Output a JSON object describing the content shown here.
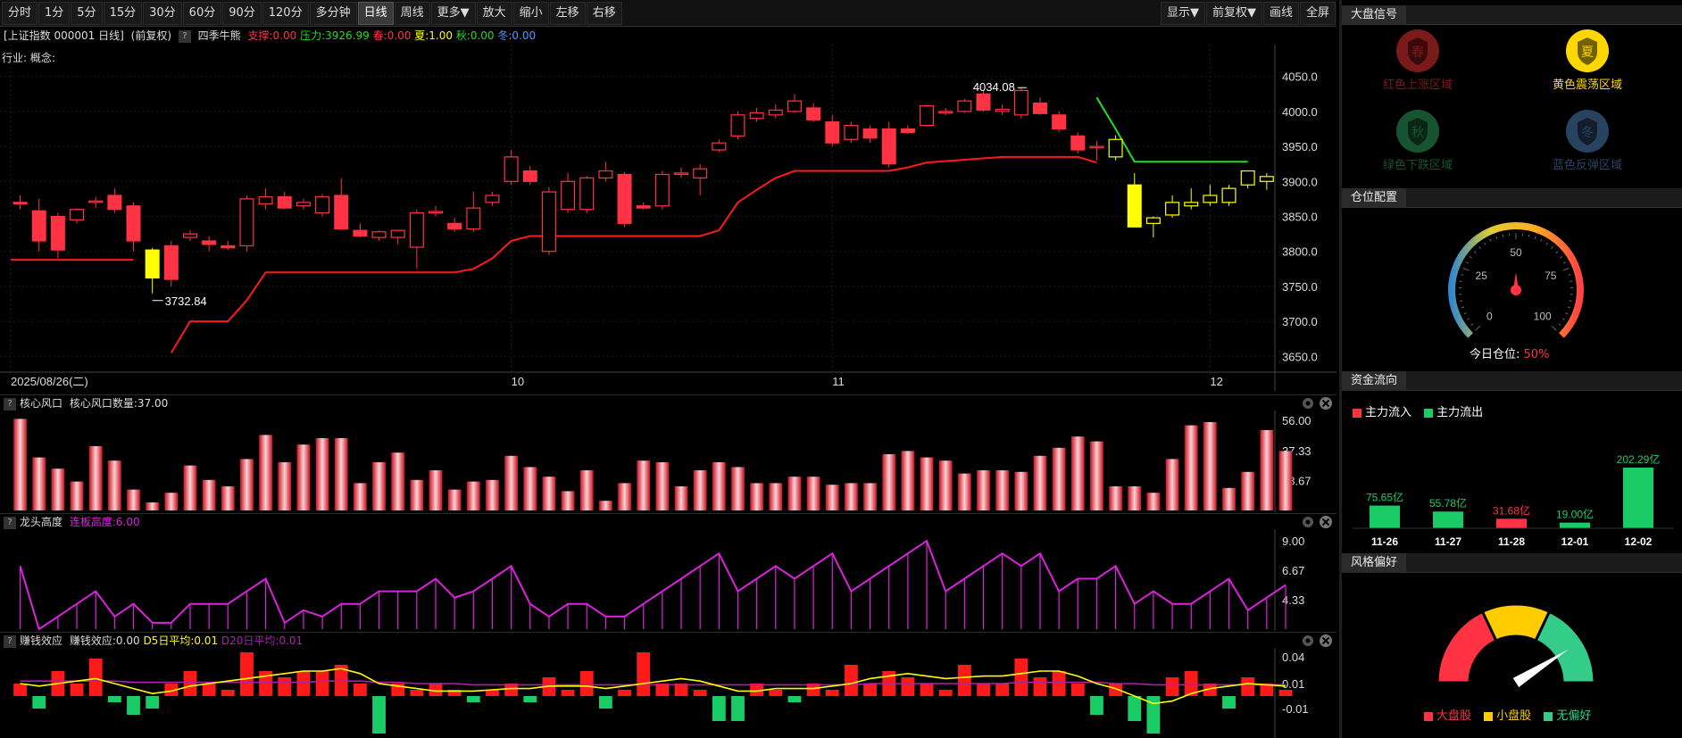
{
  "toolbar": {
    "periods": [
      "分时",
      "1分",
      "5分",
      "15分",
      "30分",
      "60分",
      "90分",
      "120分",
      "多分钟",
      "日线",
      "周线",
      "更多▼",
      "放大",
      "缩小",
      "左移",
      "右移"
    ],
    "active": "日线",
    "right_buttons": [
      "显示▼",
      "前复权▼",
      "画线",
      "全屏"
    ]
  },
  "info": {
    "security": "[上证指数 000001 日线]",
    "adjust": "(前复权)",
    "help": "?",
    "indicator": "四季牛熊",
    "support": "支撑:0.00",
    "pressure": "压力:3926.99",
    "spring": "春:0.00",
    "summer": "夏:1.00",
    "autumn": "秋:0.00",
    "winter": "冬:0.00",
    "industry": "行业: 概念:"
  },
  "colors": {
    "up": "#ff3344",
    "down": "#1acc66",
    "yellow": "#ffff00",
    "magenta": "#dd22dd",
    "line_red": "#ff1a1a",
    "line_green": "#22dd22"
  },
  "main_chart": {
    "y_ticks": [
      "4050.0",
      "4000.0",
      "3950.0",
      "3900.0",
      "3850.0",
      "3800.0",
      "3750.0",
      "3700.0",
      "3650.0"
    ],
    "y_min": 3630,
    "y_max": 4070,
    "x_labels": [
      {
        "label": "2025/08/26(二)",
        "idx": 0
      },
      {
        "label": "10",
        "idx": 26
      },
      {
        "label": "11",
        "idx": 43
      },
      {
        "label": "12",
        "idx": 63
      }
    ],
    "high_label": "4034.08",
    "low_label": "3732.84",
    "candles": [
      [
        3870,
        3880,
        3860,
        3868,
        "r"
      ],
      [
        3858,
        3875,
        3800,
        3815,
        "r"
      ],
      [
        3850,
        3855,
        3790,
        3802,
        "r"
      ],
      [
        3845,
        3862,
        3840,
        3860,
        "r"
      ],
      [
        3870,
        3878,
        3862,
        3872,
        "r"
      ],
      [
        3880,
        3890,
        3855,
        3860,
        "r"
      ],
      [
        3865,
        3870,
        3800,
        3815,
        "r"
      ],
      [
        3802,
        3805,
        3740,
        3762,
        "y"
      ],
      [
        3808,
        3815,
        3750,
        3760,
        "r"
      ],
      [
        3820,
        3830,
        3815,
        3825,
        "r"
      ],
      [
        3815,
        3822,
        3800,
        3810,
        "r"
      ],
      [
        3808,
        3815,
        3802,
        3805,
        "r"
      ],
      [
        3808,
        3880,
        3800,
        3875,
        "r"
      ],
      [
        3868,
        3890,
        3860,
        3878,
        "r"
      ],
      [
        3878,
        3885,
        3860,
        3862,
        "r"
      ],
      [
        3865,
        3875,
        3860,
        3870,
        "r"
      ],
      [
        3855,
        3882,
        3850,
        3878,
        "r"
      ],
      [
        3880,
        3905,
        3830,
        3832,
        "r"
      ],
      [
        3830,
        3840,
        3820,
        3822,
        "r"
      ],
      [
        3820,
        3830,
        3815,
        3828,
        "r"
      ],
      [
        3820,
        3830,
        3810,
        3830,
        "r"
      ],
      [
        3806,
        3860,
        3775,
        3855,
        "r"
      ],
      [
        3855,
        3865,
        3850,
        3857,
        "r"
      ],
      [
        3840,
        3848,
        3828,
        3832,
        "r"
      ],
      [
        3832,
        3885,
        3828,
        3862,
        "r"
      ],
      [
        3870,
        3885,
        3865,
        3880,
        "r"
      ],
      [
        3900,
        3945,
        3895,
        3935,
        "r"
      ],
      [
        3915,
        3922,
        3895,
        3900,
        "r"
      ],
      [
        3800,
        3892,
        3795,
        3885,
        "r"
      ],
      [
        3860,
        3912,
        3855,
        3900,
        "r"
      ],
      [
        3860,
        3908,
        3855,
        3905,
        "r"
      ],
      [
        3905,
        3928,
        3900,
        3915,
        "r"
      ],
      [
        3910,
        3913,
        3835,
        3840,
        "r"
      ],
      [
        3865,
        3870,
        3860,
        3862,
        "r"
      ],
      [
        3865,
        3915,
        3860,
        3910,
        "r"
      ],
      [
        3910,
        3920,
        3905,
        3912,
        "r"
      ],
      [
        3905,
        3925,
        3880,
        3918,
        "r"
      ],
      [
        3945,
        3960,
        3942,
        3955,
        "r"
      ],
      [
        3965,
        4000,
        3960,
        3995,
        "r"
      ],
      [
        3990,
        4005,
        3985,
        3998,
        "r"
      ],
      [
        3995,
        4010,
        3990,
        4002,
        "r"
      ],
      [
        4000,
        4025,
        3998,
        4015,
        "r"
      ],
      [
        4005,
        4012,
        3985,
        3988,
        "r"
      ],
      [
        3985,
        3995,
        3950,
        3955,
        "r"
      ],
      [
        3960,
        3985,
        3955,
        3980,
        "r"
      ],
      [
        3975,
        3980,
        3955,
        3962,
        "r"
      ],
      [
        3975,
        3985,
        3920,
        3925,
        "r"
      ],
      [
        3975,
        3980,
        3968,
        3970,
        "r"
      ],
      [
        3980,
        4010,
        3978,
        4008,
        "r"
      ],
      [
        3998,
        4005,
        3995,
        4000,
        "r"
      ],
      [
        4000,
        4018,
        3998,
        4015,
        "r"
      ],
      [
        4025,
        4030,
        4000,
        4002,
        "r"
      ],
      [
        4000,
        4010,
        3995,
        4003,
        "r"
      ],
      [
        3995,
        4034,
        3990,
        4030,
        "r"
      ],
      [
        4012,
        4020,
        3995,
        3997,
        "r"
      ],
      [
        3995,
        4000,
        3970,
        3975,
        "r"
      ],
      [
        3965,
        3970,
        3940,
        3945,
        "r"
      ],
      [
        3948,
        3958,
        3930,
        3950,
        "r"
      ],
      [
        3935,
        3966,
        3930,
        3960,
        "y"
      ],
      [
        3895,
        3912,
        3835,
        3835,
        "y"
      ],
      [
        3840,
        3850,
        3820,
        3848,
        "y"
      ],
      [
        3852,
        3880,
        3848,
        3870,
        "y"
      ],
      [
        3865,
        3890,
        3860,
        3870,
        "y"
      ],
      [
        3870,
        3895,
        3865,
        3880,
        "y"
      ],
      [
        3870,
        3895,
        3865,
        3890,
        "y"
      ],
      [
        3895,
        3916,
        3890,
        3915,
        "y"
      ],
      [
        3900,
        3912,
        3888,
        3907,
        "y"
      ]
    ],
    "support_line": [
      [
        0,
        3788
      ],
      [
        6,
        3788
      ],
      [
        8,
        3655
      ],
      [
        9,
        3700
      ],
      [
        11,
        3700
      ],
      [
        12,
        3730
      ],
      [
        13,
        3770
      ],
      [
        23,
        3770
      ],
      [
        24,
        3775
      ],
      [
        25,
        3790
      ],
      [
        26,
        3815
      ],
      [
        27,
        3822
      ],
      [
        35,
        3822
      ],
      [
        36,
        3822
      ],
      [
        37,
        3830
      ],
      [
        38,
        3870
      ],
      [
        39,
        3888
      ],
      [
        40,
        3905
      ],
      [
        41,
        3915
      ],
      [
        46,
        3915
      ],
      [
        47,
        3920
      ],
      [
        48,
        3927
      ],
      [
        52,
        3935
      ],
      [
        56,
        3935
      ],
      [
        57,
        3927
      ]
    ],
    "pressure_line": [
      [
        57,
        4020
      ],
      [
        58,
        3975
      ],
      [
        59,
        3928
      ],
      [
        65,
        3928
      ]
    ]
  },
  "panel_core": {
    "title": "核心风口",
    "value_label": "核心风口数量:37.00",
    "y_ticks": [
      "56.00",
      "37.33",
      "18.67"
    ],
    "max": 60,
    "values": [
      57,
      33,
      26,
      18,
      40,
      31,
      13,
      5,
      11,
      28,
      19,
      15,
      32,
      47,
      30,
      41,
      45,
      45,
      17,
      30,
      36,
      19,
      25,
      13,
      18,
      19,
      34,
      27,
      21,
      12,
      25,
      6,
      17,
      31,
      30,
      15,
      25,
      30,
      27,
      17,
      17,
      21,
      21,
      16,
      17,
      17,
      35,
      37,
      33,
      31,
      23,
      25,
      25,
      24,
      34,
      39,
      46,
      43,
      15,
      15,
      11,
      32,
      53,
      55,
      14,
      24,
      50,
      37
    ]
  },
  "panel_dragon": {
    "title": "龙头高度",
    "value_label": "连板高度:6.00",
    "y_ticks": [
      "9.00",
      "6.67",
      "4.33"
    ],
    "min": 2,
    "max": 9.5,
    "values": [
      7,
      2,
      3,
      4,
      5,
      3,
      4,
      2.5,
      2.5,
      4,
      4,
      4,
      5,
      6,
      2.5,
      3.5,
      3,
      4,
      4,
      5,
      5,
      5,
      6,
      4.5,
      5,
      6,
      7,
      4,
      3,
      4,
      4,
      3,
      3,
      4,
      5,
      6,
      7,
      8,
      5,
      6,
      7,
      6,
      7,
      8,
      5,
      6,
      7,
      8,
      9,
      5,
      6,
      7,
      8,
      7,
      8,
      5,
      6,
      6,
      7,
      4,
      5,
      4,
      4,
      5,
      6,
      3.5,
      4.5,
      5.5
    ]
  },
  "panel_money": {
    "title": "赚钱效应",
    "value_label": "赚钱效应:0.00",
    "d5": "D5日平均:0.01",
    "d20": "D20日平均:0.01",
    "y_ticks": [
      "0.04",
      "0.01",
      "-0.01"
    ],
    "values": [
      0.01,
      -0.01,
      0.02,
      0.01,
      0.03,
      -0.005,
      -0.015,
      -0.01,
      0.01,
      0.02,
      0.01,
      0.005,
      0.035,
      0.02,
      0.015,
      0.02,
      0.02,
      0.025,
      0.01,
      -0.03,
      0.01,
      0.005,
      0.01,
      0.005,
      -0.005,
      0.005,
      0.01,
      -0.005,
      0.015,
      0.005,
      0.02,
      -0.01,
      0.005,
      0.035,
      0.01,
      0.01,
      0.005,
      -0.02,
      -0.02,
      0.01,
      0.005,
      -0.005,
      0.01,
      0.005,
      0.025,
      0.01,
      0.02,
      0.015,
      0.01,
      0.005,
      0.025,
      0.01,
      0.01,
      0.03,
      0.015,
      0.02,
      0.01,
      -0.015,
      0.01,
      -0.02,
      -0.03,
      0.015,
      0.02,
      0.01,
      -0.01,
      0.015,
      0.01,
      0.005
    ],
    "d5_values": [
      0.01,
      0.008,
      0.01,
      0.012,
      0.014,
      0.01,
      0.006,
      0.002,
      0.004,
      0.008,
      0.01,
      0.012,
      0.014,
      0.016,
      0.018,
      0.02,
      0.02,
      0.022,
      0.018,
      0.01,
      0.008,
      0.006,
      0.004,
      0.004,
      0.004,
      0.005,
      0.006,
      0.006,
      0.008,
      0.008,
      0.008,
      0.006,
      0.008,
      0.01,
      0.012,
      0.014,
      0.012,
      0.008,
      0.004,
      0.004,
      0.006,
      0.006,
      0.006,
      0.008,
      0.01,
      0.014,
      0.016,
      0.018,
      0.016,
      0.014,
      0.015,
      0.016,
      0.016,
      0.018,
      0.02,
      0.02,
      0.016,
      0.01,
      0.006,
      0,
      -0.006,
      -0.004,
      0.002,
      0.006,
      0.008,
      0.01,
      0.009,
      0.008
    ],
    "d20_values": [
      0.012,
      0.012,
      0.012,
      0.012,
      0.012,
      0.012,
      0.011,
      0.011,
      0.011,
      0.011,
      0.011,
      0.011,
      0.011,
      0.011,
      0.011,
      0.011,
      0.012,
      0.012,
      0.012,
      0.011,
      0.011,
      0.01,
      0.01,
      0.01,
      0.009,
      0.009,
      0.009,
      0.009,
      0.009,
      0.009,
      0.009,
      0.009,
      0.009,
      0.009,
      0.009,
      0.009,
      0.009,
      0.009,
      0.009,
      0.009,
      0.009,
      0.009,
      0.009,
      0.009,
      0.009,
      0.01,
      0.01,
      0.01,
      0.01,
      0.01,
      0.01,
      0.01,
      0.01,
      0.011,
      0.011,
      0.011,
      0.011,
      0.011,
      0.01,
      0.01,
      0.009,
      0.009,
      0.009,
      0.009,
      0.009,
      0.009,
      0.009,
      0.009
    ]
  },
  "right": {
    "signal_title": "大盘信号",
    "signals": [
      {
        "label": "红色上涨区域",
        "glyph": "春",
        "color": "#e03030",
        "active": false
      },
      {
        "label": "黄色震荡区域",
        "glyph": "夏",
        "color": "#ffd700",
        "active": true
      },
      {
        "label": "绿色下跌区域",
        "glyph": "秋",
        "color": "#2a9a5a",
        "active": false
      },
      {
        "label": "蓝色反弹区域",
        "glyph": "冬",
        "color": "#4a7ab0",
        "active": false
      }
    ],
    "position_title": "仓位配置",
    "gauge_ticks": [
      "0",
      "25",
      "50",
      "75",
      "100"
    ],
    "position_label": "今日仓位:",
    "position_value": "50%",
    "position_fraction": 0.5,
    "flow_title": "资金流向",
    "flow_in": "主力流入",
    "flow_out": "主力流出",
    "flow": [
      {
        "date": "11-26",
        "value": 75.65,
        "label": "75.65亿",
        "dir": "out"
      },
      {
        "date": "11-27",
        "value": 55.78,
        "label": "55.78亿",
        "dir": "out"
      },
      {
        "date": "11-28",
        "value": 31.68,
        "label": "31.68亿",
        "dir": "in"
      },
      {
        "date": "12-01",
        "value": 19.0,
        "label": "19.00亿",
        "dir": "out"
      },
      {
        "date": "12-02",
        "value": 202.29,
        "label": "202.29亿",
        "dir": "out"
      }
    ],
    "style_title": "风格偏好",
    "style_legend": [
      "大盘股",
      "小盘股",
      "无偏好"
    ],
    "style_pointer_fraction": 0.82
  }
}
